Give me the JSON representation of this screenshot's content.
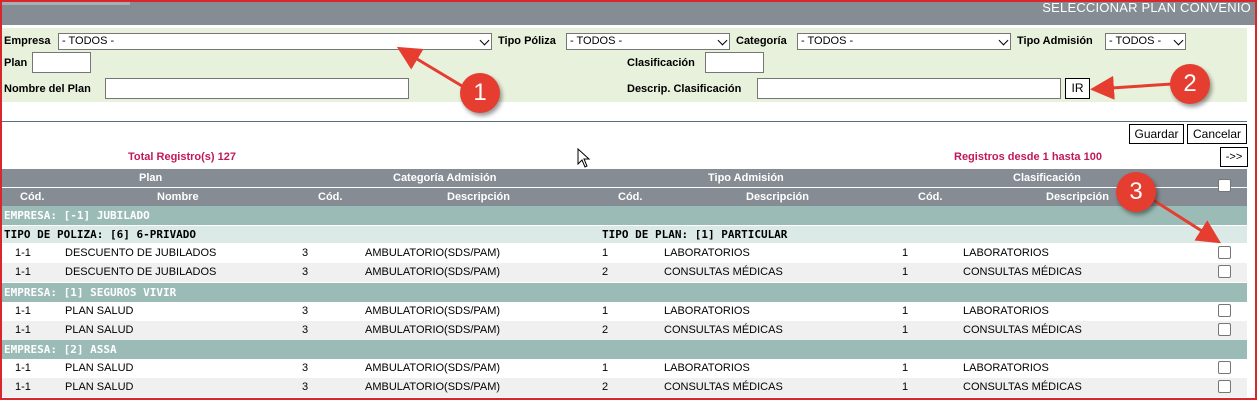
{
  "header": {
    "title": "SELECCIONAR PLAN CONVENIO"
  },
  "filters": {
    "empresa_label": "Empresa",
    "empresa_value": "- TODOS -",
    "tipo_poliza_label": "Tipo Póliza",
    "tipo_poliza_value": "- TODOS -",
    "categoria_label": "Categoría",
    "categoria_value": "- TODOS -",
    "tipo_admision_label": "Tipo Admisión",
    "tipo_admision_value": "- TODOS -",
    "plan_label": "Plan",
    "plan_value": "",
    "clasificacion_label": "Clasificación",
    "clasificacion_value": "",
    "nombre_plan_label": "Nombre del Plan",
    "nombre_plan_value": "",
    "descrip_clasificacion_label": "Descrip. Clasificación",
    "descrip_clasificacion_value": "",
    "go_label": "IR"
  },
  "actions": {
    "guardar": "Guardar",
    "cancelar": "Cancelar",
    "next": "->>"
  },
  "summary": {
    "total": "Total Registro(s) 127",
    "range": "Registros desde 1 hasta 100"
  },
  "table": {
    "group_headers": [
      "Plan",
      "Categoría Admisión",
      "Tipo Admisión",
      "Clasificación"
    ],
    "columns": [
      "Cód.",
      "Nombre",
      "Cód.",
      "Descripción",
      "Cód.",
      "Descripción",
      "Cód.",
      "Descripción"
    ],
    "groups": [
      {
        "empresa": "EMPRESA: [-1] JUBILADO",
        "tipo_poliza": "TIPO DE POLIZA: [6] 6-PRIVADO",
        "tipo_plan": "TIPO DE PLAN: [1] PARTICULAR",
        "rows": [
          {
            "plan_cod": "1-1",
            "plan_nombre": "DESCUENTO DE JUBILADOS",
            "cat_cod": "3",
            "cat_desc": "AMBULATORIO(SDS/PAM)",
            "tipo_cod": "1",
            "tipo_desc": "LABORATORIOS",
            "clas_cod": "1",
            "clas_desc": "LABORATORIOS"
          },
          {
            "plan_cod": "1-1",
            "plan_nombre": "DESCUENTO DE JUBILADOS",
            "cat_cod": "3",
            "cat_desc": "AMBULATORIO(SDS/PAM)",
            "tipo_cod": "2",
            "tipo_desc": "CONSULTAS MÉDICAS",
            "clas_cod": "1",
            "clas_desc": "CONSULTAS MÉDICAS"
          }
        ]
      },
      {
        "empresa": "EMPRESA: [1] SEGUROS VIVIR",
        "rows": [
          {
            "plan_cod": "1-1",
            "plan_nombre": "PLAN SALUD",
            "cat_cod": "3",
            "cat_desc": "AMBULATORIO(SDS/PAM)",
            "tipo_cod": "1",
            "tipo_desc": "LABORATORIOS",
            "clas_cod": "1",
            "clas_desc": "LABORATORIOS"
          },
          {
            "plan_cod": "1-1",
            "plan_nombre": "PLAN SALUD",
            "cat_cod": "3",
            "cat_desc": "AMBULATORIO(SDS/PAM)",
            "tipo_cod": "2",
            "tipo_desc": "CONSULTAS MÉDICAS",
            "clas_cod": "1",
            "clas_desc": "CONSULTAS MÉDICAS"
          }
        ]
      },
      {
        "empresa": "EMPRESA: [2] ASSA",
        "rows": [
          {
            "plan_cod": "1-1",
            "plan_nombre": "PLAN SALUD",
            "cat_cod": "3",
            "cat_desc": "AMBULATORIO(SDS/PAM)",
            "tipo_cod": "1",
            "tipo_desc": "LABORATORIOS",
            "clas_cod": "1",
            "clas_desc": "LABORATORIOS"
          },
          {
            "plan_cod": "1-1",
            "plan_nombre": "PLAN SALUD",
            "cat_cod": "3",
            "cat_desc": "AMBULATORIO(SDS/PAM)",
            "tipo_cod": "2",
            "tipo_desc": "CONSULTAS MÉDICAS",
            "clas_cod": "1",
            "clas_desc": "CONSULTAS MÉDICAS"
          }
        ]
      }
    ]
  },
  "annotations": [
    "1",
    "2",
    "3"
  ],
  "colors": {
    "accent_red": "#e53d2f",
    "header_gray": "#868c93",
    "group_teal": "#9bbbb6",
    "filter_bg": "#e8f1dc",
    "total_text": "#c2185b"
  }
}
